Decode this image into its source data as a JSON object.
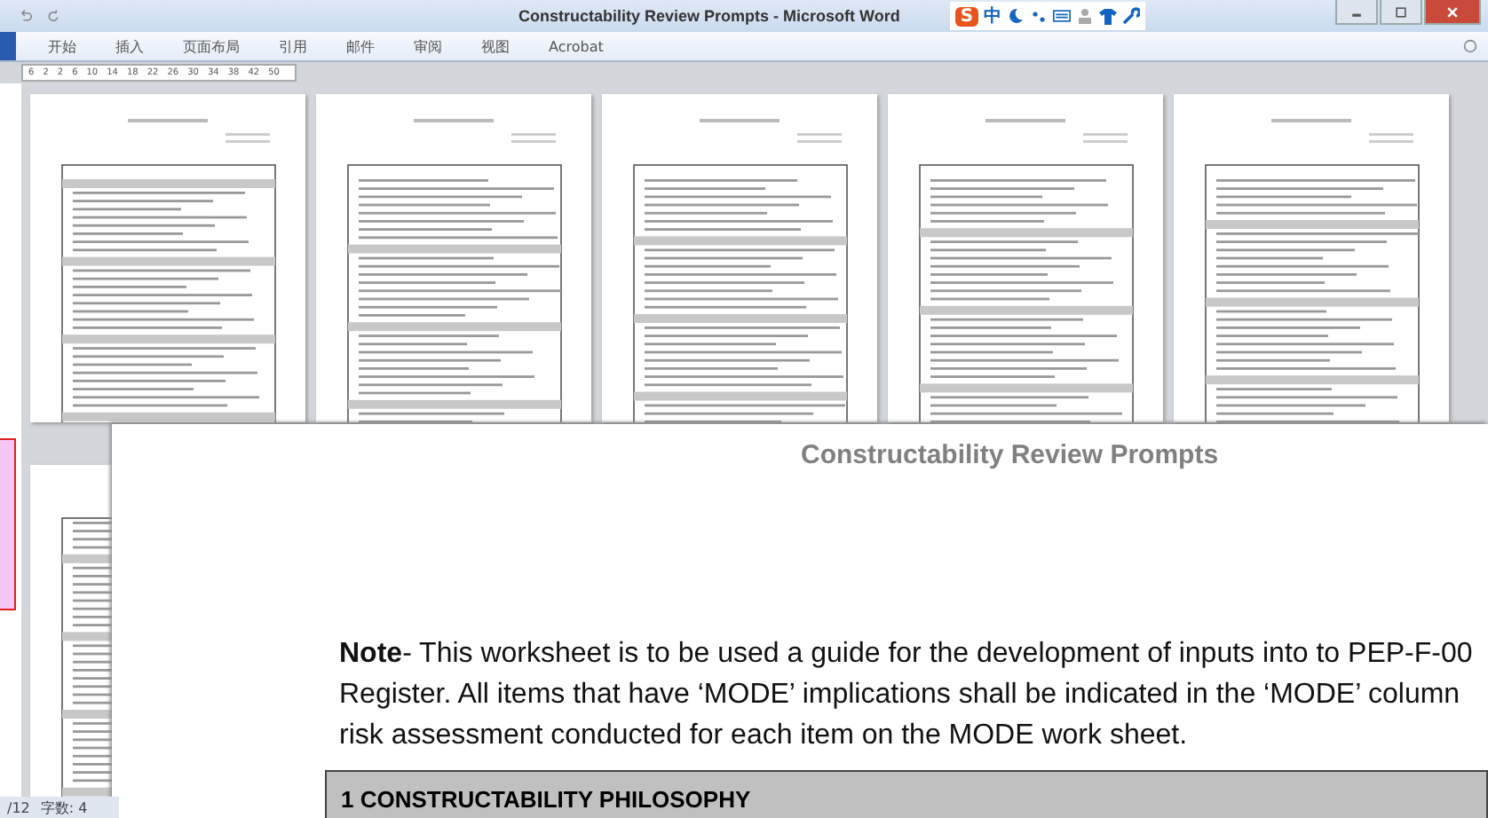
{
  "window": {
    "title": "Constructability Review Prompts - Microsoft Word"
  },
  "ime_bar": {
    "logo": "S",
    "mode": "中"
  },
  "ribbon_tabs": [
    {
      "label": "开始"
    },
    {
      "label": "插入"
    },
    {
      "label": "页面布局"
    },
    {
      "label": "引用"
    },
    {
      "label": "邮件"
    },
    {
      "label": "审阅"
    },
    {
      "label": "视图"
    },
    {
      "label": "Acrobat"
    }
  ],
  "ruler": {
    "marks": [
      "6",
      "2",
      "2",
      "6",
      "10",
      "14",
      "18",
      "22",
      "26",
      "30",
      "34",
      "38",
      "42",
      "50"
    ]
  },
  "zoomed_page": {
    "heading": "Constructability Review Prompts",
    "note": "**Note**- This worksheet is to be used a guide for the development of inputs into to PEP-F-00\nRegister. All items that have ‘MODE’ implications shall be indicated in the ‘MODE’ column\nrisk assessment conducted for each item on the MODE work sheet.",
    "section_heading": "1  CONSTRUCTABILITY PHILOSOPHY"
  },
  "status_bar": {
    "page": "/12",
    "words": "字数: 4"
  }
}
